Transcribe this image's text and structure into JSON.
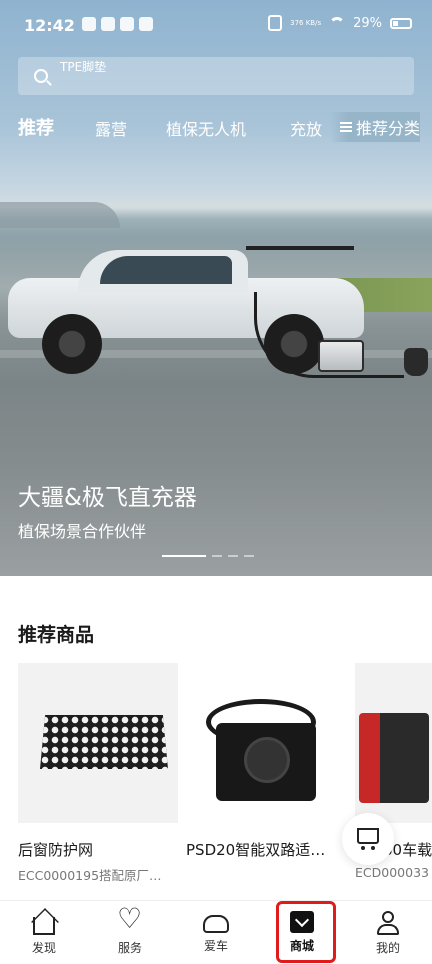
{
  "status_bar": {
    "time": "12:42",
    "net_speed": "376 KB/s",
    "battery": "29%"
  },
  "search": {
    "placeholder": "TPE脚垫"
  },
  "tabs": [
    {
      "label": "推荐",
      "active": true
    },
    {
      "label": "露营",
      "active": false
    },
    {
      "label": "植保无人机",
      "active": false
    },
    {
      "label": "充放",
      "active": false
    }
  ],
  "category_button": {
    "label": "推荐分类"
  },
  "banner": {
    "title": "大疆&极飞直充器",
    "subtitle": "植保场景合作伙伴",
    "slide_count": 4,
    "active_slide": 1
  },
  "recommend": {
    "title": "推荐商品",
    "products": [
      {
        "name": "后窗防护网",
        "code": "ECC0000195搭配原厂…"
      },
      {
        "name": "PSD20智能双路适…",
        "code": ""
      },
      {
        "name": "80车载",
        "code": "ECD000033"
      }
    ]
  },
  "bottom_nav": [
    {
      "label": "发现",
      "icon": "home-icon"
    },
    {
      "label": "服务",
      "icon": "heart-icon"
    },
    {
      "label": "爱车",
      "icon": "car-icon"
    },
    {
      "label": "商城",
      "icon": "shop-icon",
      "active": true
    },
    {
      "label": "我的",
      "icon": "user-icon"
    }
  ],
  "colors": {
    "highlight_frame": "#e01b1b",
    "accent": "#111111"
  }
}
